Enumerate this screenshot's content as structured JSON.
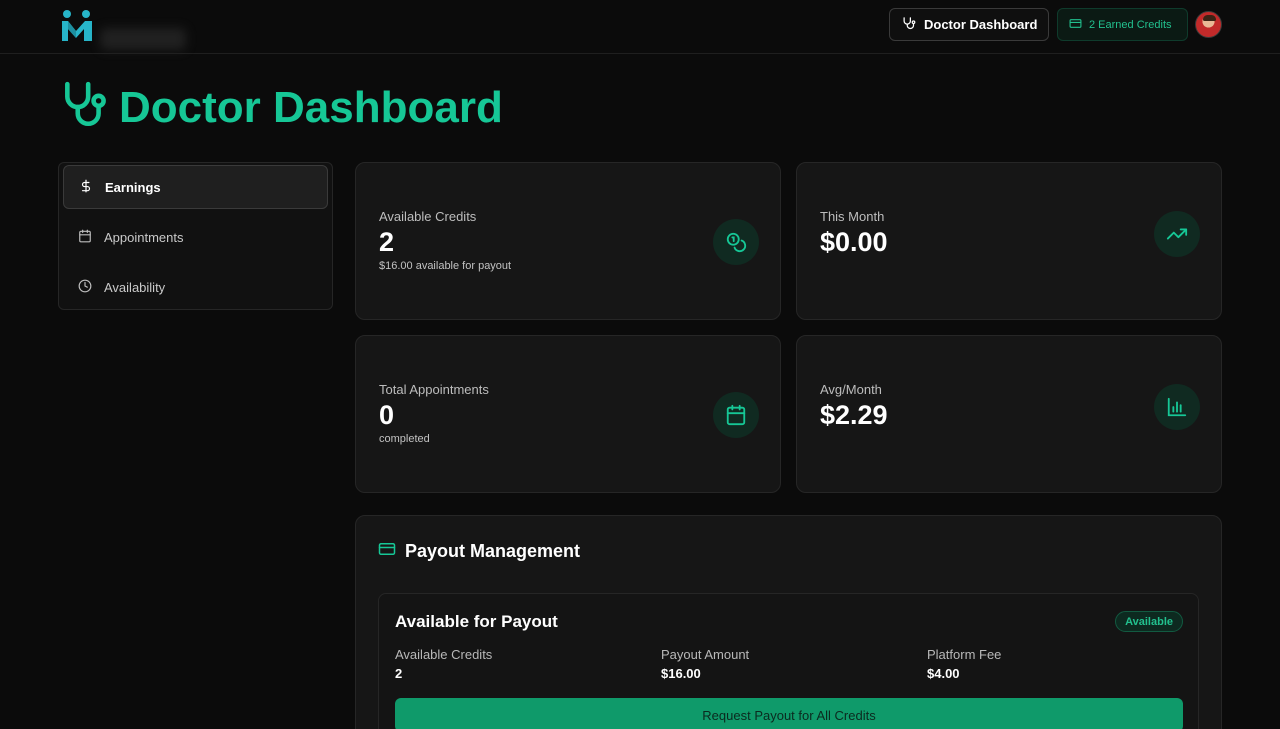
{
  "header": {
    "nav_button_label": "Doctor Dashboard",
    "credits_button_label": "2 Earned Credits"
  },
  "page": {
    "title": "Doctor Dashboard"
  },
  "sidebar": {
    "items": [
      {
        "label": "Earnings",
        "icon": "dollar-icon",
        "active": true
      },
      {
        "label": "Appointments",
        "icon": "calendar-icon",
        "active": false
      },
      {
        "label": "Availability",
        "icon": "clock-icon",
        "active": false
      }
    ]
  },
  "stats": {
    "available_credits": {
      "label": "Available Credits",
      "value": "2",
      "sub": "$16.00 available for payout",
      "icon": "coins-icon"
    },
    "this_month": {
      "label": "This Month",
      "value": "$0.00",
      "icon": "trending-up-icon"
    },
    "total_appointments": {
      "label": "Total Appointments",
      "value": "0",
      "sub": "completed",
      "icon": "calendar-icon"
    },
    "avg_month": {
      "label": "Avg/Month",
      "value": "$2.29",
      "icon": "bar-chart-icon"
    }
  },
  "payout": {
    "title": "Payout Management",
    "inner_title": "Available for Payout",
    "badge": "Available",
    "columns": [
      {
        "label": "Available Credits",
        "value": "2"
      },
      {
        "label": "Payout Amount",
        "value": "$16.00"
      },
      {
        "label": "Platform Fee",
        "value": "$4.00"
      }
    ],
    "button_label": "Request Payout for All Credits"
  },
  "colors": {
    "accent": "#16c796",
    "background": "#0b0b0b",
    "card": "#161616",
    "button": "#0f9a6a"
  }
}
